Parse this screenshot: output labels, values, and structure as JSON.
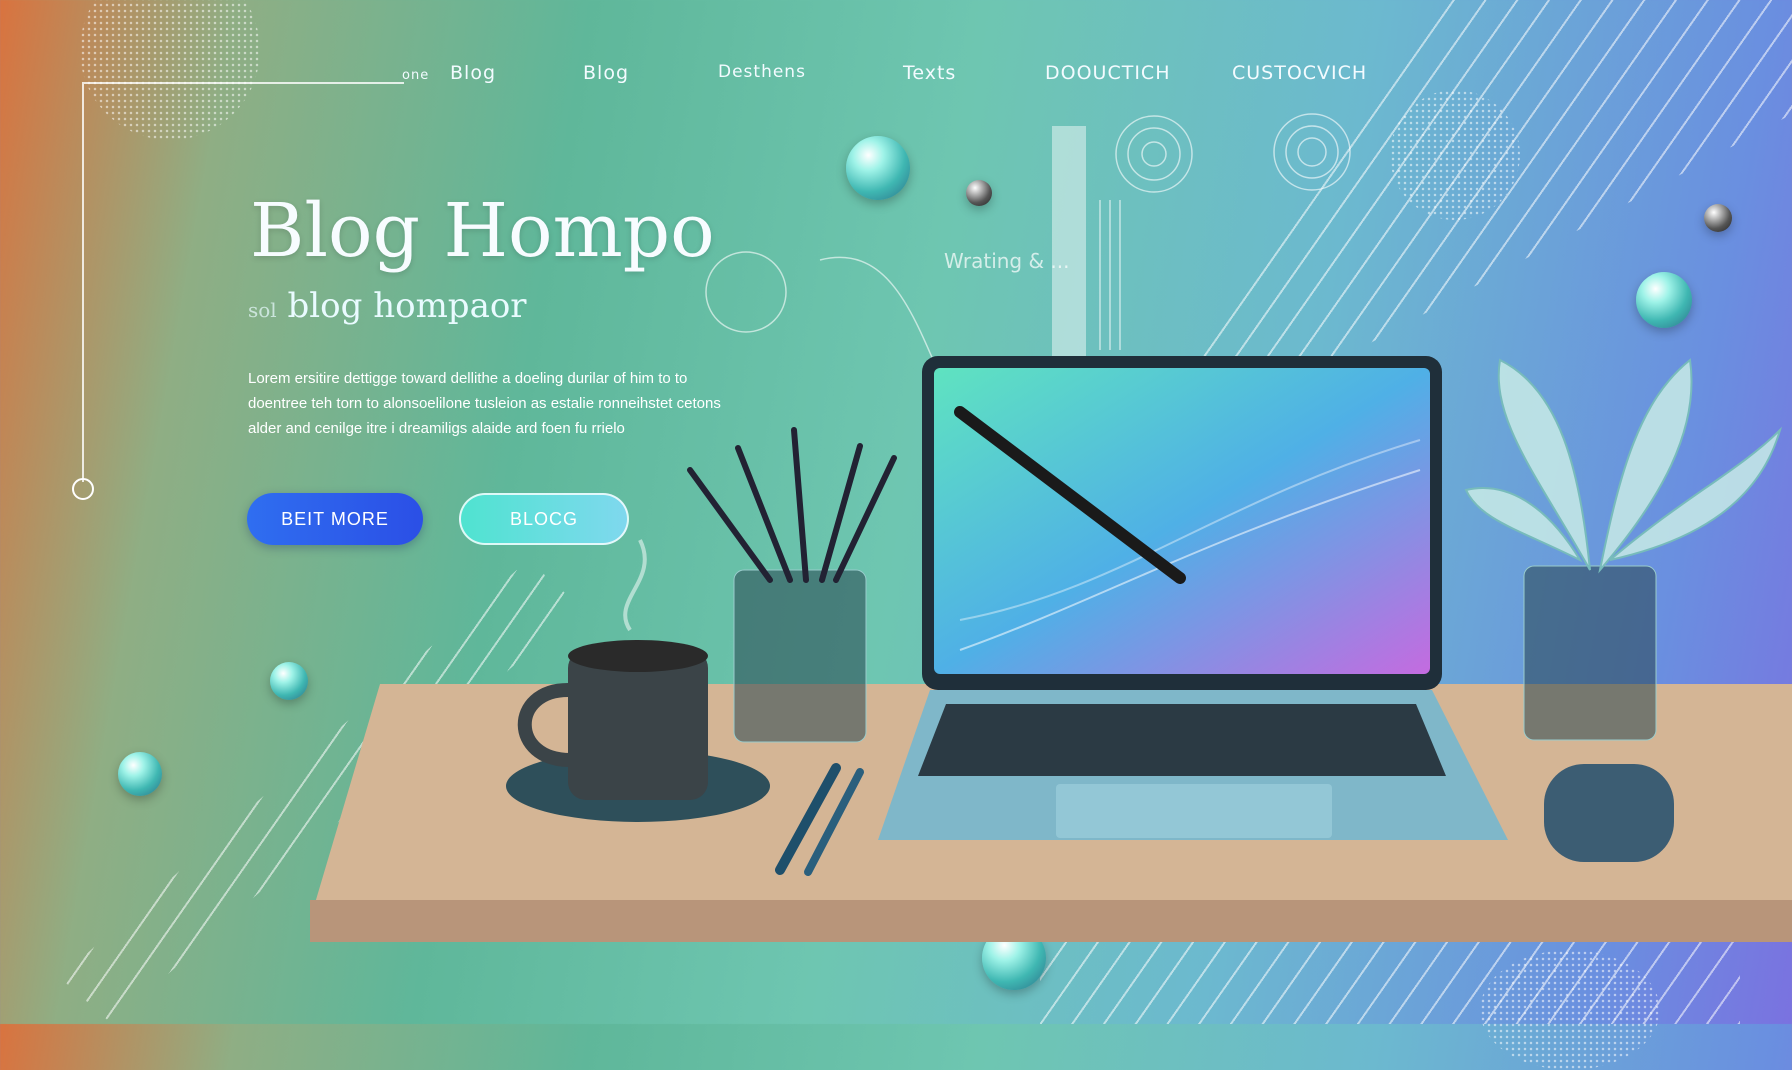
{
  "nav": {
    "items": [
      {
        "label": "Blog",
        "name": "nav-blog-1"
      },
      {
        "label": "Blog",
        "name": "nav-blog-2"
      },
      {
        "label": "Desthens",
        "name": "nav-desthens"
      },
      {
        "label": "Texts",
        "name": "nav-texts"
      },
      {
        "label": "DOOUCTICH",
        "name": "nav-dooucrich"
      },
      {
        "label": "CUSTOCVICH",
        "name": "nav-custocvich"
      }
    ],
    "prefix": "one"
  },
  "hero": {
    "title": "Blog Hompo",
    "subtitle": "blog hompaor",
    "subtitle_prefix": "sol",
    "body": "Lorem ersitire dettigge toward dellithe a doeling durilar of him to to doentree teh torn to alonsoelilone tusleion as estalie ronneihstet cetons alder and cenilge itre i dreamiligs alaide ard foen fu rrielo"
  },
  "buttons": {
    "primary_label": "BEIT MORE",
    "secondary_label": "BLOCG"
  },
  "scene": {
    "overlay_text": "Wrating & ..."
  },
  "colors": {
    "accent": "#2f6ef0",
    "secondary": "#4fe3d0",
    "desk": "#c8a888"
  }
}
